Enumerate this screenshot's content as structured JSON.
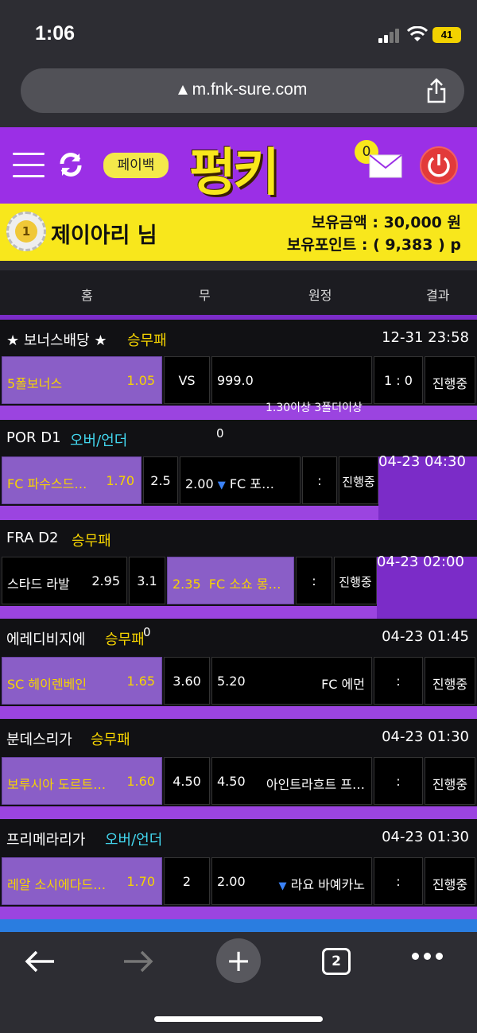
{
  "status_bar": {
    "time": "1:06",
    "battery": "41"
  },
  "url_bar": {
    "url": "m.fnk-sure.com"
  },
  "header": {
    "payback_label": "페이백",
    "logo": "펑키",
    "mail_count": "0"
  },
  "user": {
    "level": "1",
    "name": "제이아리 님",
    "balance_line": "보유금액 : 30,000 원",
    "points_line": "보유포인트 : ( 9,383 ) p"
  },
  "table_headers": {
    "home": "홈",
    "draw": "무",
    "away": "원정",
    "result": "결과"
  },
  "games": [
    {
      "league": "★ 보너스배당 ★",
      "type": "승무패",
      "time": "12-31 23:58",
      "home": "5폴보너스",
      "home_odds": "1.05",
      "mid": "VS",
      "away_odds": "999.0",
      "away": "",
      "score": "1 : 0",
      "status": "진행중",
      "note": "1.30이상 3폴더이상"
    },
    {
      "league": "POR D1",
      "type": "오버/언더",
      "time": "04-23 04:30",
      "stray": "0",
      "home": "FC 파수스드…",
      "home_odds": "1.70",
      "mid": "2.5",
      "away_odds": "2.00",
      "away": "FC 포…",
      "score": ":",
      "status": "진행중"
    },
    {
      "league": "FRA D2",
      "type": "승무패",
      "time": "04-23 02:00",
      "home": "스타드 라발",
      "home_odds": "2.95",
      "mid": "3.1",
      "away_odds": "2.35",
      "away": "FC 소쇼 몽…",
      "score": ":",
      "status": "진행중"
    },
    {
      "league": "에레디비지에",
      "type": "승무패",
      "time": "04-23 01:45",
      "stray": "0",
      "home": "SC 헤이렌베인",
      "home_odds": "1.65",
      "mid": "3.60",
      "away_odds": "5.20",
      "away": "FC 에먼",
      "score": ":",
      "status": "진행중"
    },
    {
      "league": "분데스리가",
      "type": "승무패",
      "time": "04-23 01:30",
      "home": "보루시아 도르트…",
      "home_odds": "1.60",
      "mid": "4.50",
      "away_odds": "4.50",
      "away": "아인트라흐트 프…",
      "score": ":",
      "status": "진행중"
    },
    {
      "league": "프리메라리가",
      "type": "오버/언더",
      "time": "04-23 01:30",
      "home": "레알 소시에다드…",
      "home_odds": "1.70",
      "mid": "2",
      "away_odds": "2.00",
      "away": "라요 바예카노",
      "score": ":",
      "status": "진행중"
    }
  ],
  "toolbar": {
    "tab_count": "2"
  }
}
